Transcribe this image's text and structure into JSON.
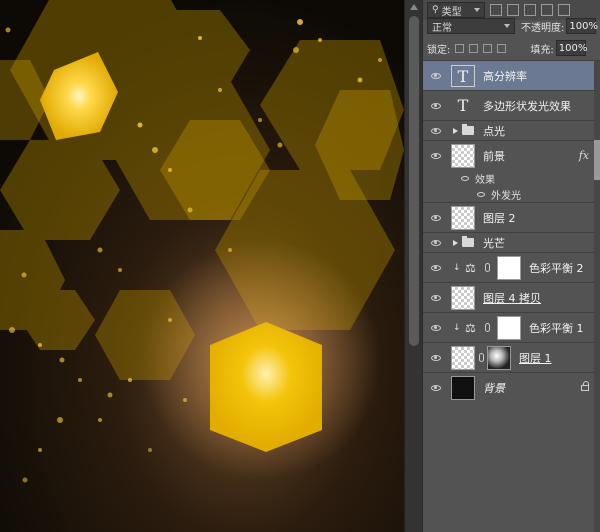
{
  "panel": {
    "filter_kind": "类型",
    "blend_mode": "正常",
    "opacity_label": "不透明度:",
    "opacity_value": "100%",
    "lock_label": "锁定:",
    "fill_label": "填充:",
    "fill_value": "100%"
  },
  "layers": [
    {
      "type": "text",
      "name": "高分辨率",
      "selected": true
    },
    {
      "type": "text",
      "name": "多边形状发光效果"
    },
    {
      "type": "group",
      "name": "点光"
    },
    {
      "type": "pixel",
      "name": "前景",
      "fx": "fx"
    },
    {
      "type": "effect-header",
      "name": "效果"
    },
    {
      "type": "effect",
      "name": "外发光"
    },
    {
      "type": "pixel",
      "name": "图层 2"
    },
    {
      "type": "group",
      "name": "光芒"
    },
    {
      "type": "adjustment",
      "name": "色彩平衡 2"
    },
    {
      "type": "pixel",
      "name": "图层 4 拷贝"
    },
    {
      "type": "adjustment",
      "name": "色彩平衡 1"
    },
    {
      "type": "masked",
      "name": "图层 1"
    },
    {
      "type": "background",
      "name": "背景"
    }
  ],
  "colors": {
    "gold": "#d9a400",
    "dark_gold": "#6b5200",
    "panel_bg": "#535353",
    "selection": "#6b7a92"
  }
}
